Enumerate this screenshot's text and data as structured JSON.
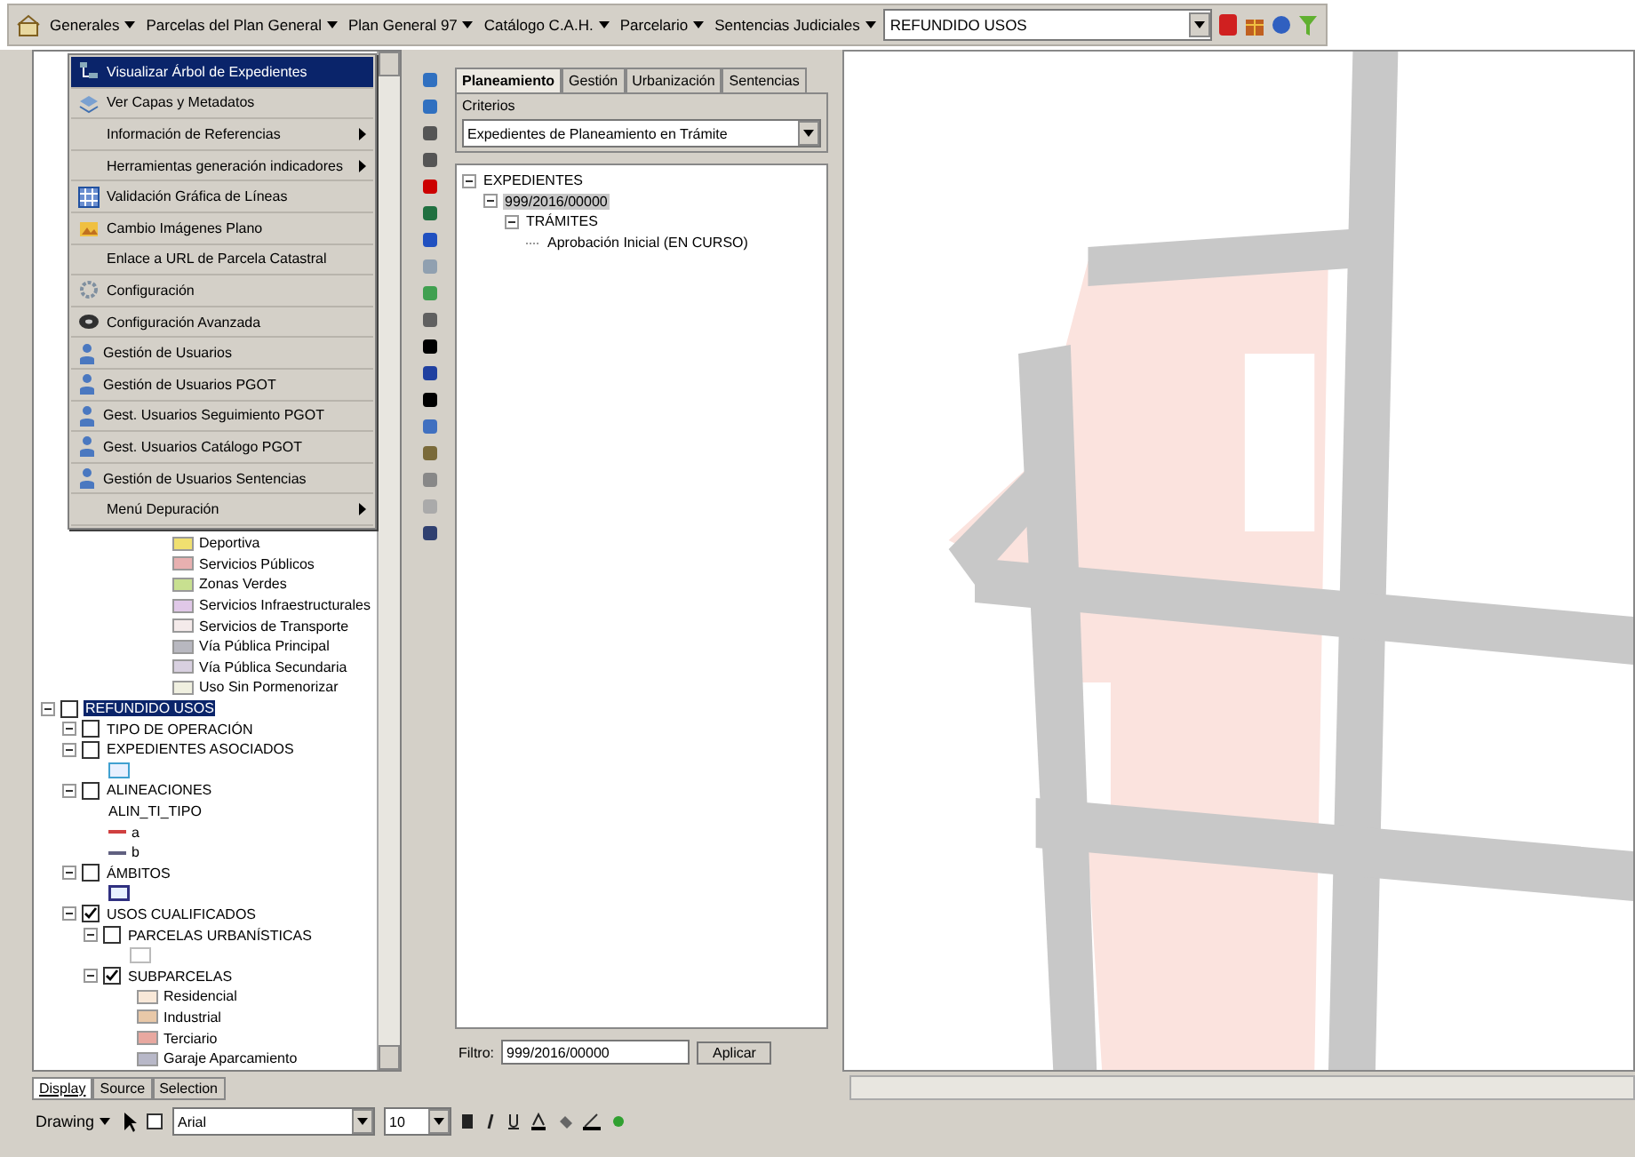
{
  "toolbar": {
    "menus": [
      {
        "label": "Generales"
      },
      {
        "label": "Parcelas del Plan General"
      },
      {
        "label": "Plan General 97"
      },
      {
        "label": "Catálogo C.A.H."
      },
      {
        "label": "Parcelario"
      },
      {
        "label": "Sentencias Judiciales"
      }
    ],
    "layer_combo": {
      "value": "REFUNDIDO USOS"
    }
  },
  "menu": {
    "items": [
      {
        "label": "Visualizar Árbol de Expedientes",
        "selected": true,
        "submenu": false,
        "kind": "tree"
      },
      {
        "label": "Ver Capas y Metadatos",
        "selected": false,
        "submenu": false,
        "kind": "layers"
      },
      {
        "label": "Información de Referencias",
        "selected": false,
        "submenu": true,
        "kind": "plain"
      },
      {
        "label": "Herramientas generación indicadores",
        "selected": false,
        "submenu": true,
        "kind": "plain"
      },
      {
        "label": "Validación Gráfica de Líneas",
        "selected": false,
        "submenu": false,
        "kind": "grid"
      },
      {
        "label": "Cambio Imágenes Plano",
        "selected": false,
        "submenu": false,
        "kind": "image"
      },
      {
        "label": "Enlace a URL de Parcela Catastral",
        "selected": false,
        "submenu": false,
        "kind": "plain"
      },
      {
        "label": "Configuración",
        "selected": false,
        "submenu": false,
        "kind": "gear"
      },
      {
        "label": "Configuración Avanzada",
        "selected": false,
        "submenu": false,
        "kind": "disk"
      },
      {
        "label": "Gestión de Usuarios",
        "selected": false,
        "submenu": false,
        "kind": "user"
      },
      {
        "label": "Gestión de Usuarios PGOT",
        "selected": false,
        "submenu": false,
        "kind": "user"
      },
      {
        "label": "Gest. Usuarios Seguimiento PGOT",
        "selected": false,
        "submenu": false,
        "kind": "user"
      },
      {
        "label": "Gest. Usuarios Catálogo PGOT",
        "selected": false,
        "submenu": false,
        "kind": "user"
      },
      {
        "label": "Gestión de Usuarios Sentencias",
        "selected": false,
        "submenu": false,
        "kind": "user"
      },
      {
        "label": "Menú Depuración",
        "selected": false,
        "submenu": true,
        "kind": "plain"
      }
    ]
  },
  "toc": {
    "legend_top": [
      {
        "label": "Deportiva",
        "color": "#f0e070"
      },
      {
        "label": "Servicios Públicos",
        "color": "#e8b0b0"
      },
      {
        "label": "Zonas Verdes",
        "color": "#c8e090"
      },
      {
        "label": "Servicios Infraestructurales",
        "color": "#e0c8e8"
      },
      {
        "label": "Servicios de Transporte",
        "color": "#f4eaea"
      },
      {
        "label": "Vía Pública Principal",
        "color": "#b8b8c0"
      },
      {
        "label": "Vía Pública Secundaria",
        "color": "#d8d0e0"
      },
      {
        "label": "Uso Sin Pormenorizar",
        "color": "#f0f0e0"
      }
    ],
    "layers": [
      {
        "label": "REFUNDIDO USOS",
        "checked": false,
        "selected": true,
        "children": [
          {
            "label": "TIPO DE OPERACIÓN",
            "checked": false,
            "selected": false,
            "kind": "plain"
          },
          {
            "label": "EXPEDIENTES ASOCIADOS",
            "checked": false,
            "selected": false,
            "kind": "polygon"
          },
          {
            "label": "ALINEACIONES",
            "checked": false,
            "selected": false,
            "kind": "lines",
            "field": "ALIN_TI_TIPO",
            "lines": [
              {
                "label": "a",
                "color": "#d04040"
              },
              {
                "label": "b",
                "color": "#606080"
              }
            ]
          },
          {
            "label": "ÁMBITOS",
            "checked": false,
            "selected": false,
            "kind": "box"
          },
          {
            "label": "USOS CUALIFICADOS",
            "checked": true,
            "selected": false,
            "children": [
              {
                "label": "PARCELAS URBANÍSTICAS",
                "checked": false,
                "selected": false,
                "kind": "empty"
              },
              {
                "label": "SUBPARCELAS",
                "checked": true,
                "selected": false,
                "kind": "legend",
                "legend": [
                  {
                    "label": "Residencial",
                    "color": "#f8e8d8"
                  },
                  {
                    "label": "Industrial",
                    "color": "#e8c8a8"
                  },
                  {
                    "label": "Terciario",
                    "color": "#e8a8a0"
                  },
                  {
                    "label": "Garaje Aparcamiento",
                    "color": "#b8b8c8"
                  }
                ]
              }
            ]
          }
        ]
      }
    ],
    "tabs": [
      {
        "label": "Display",
        "selected": true
      },
      {
        "label": "Source",
        "selected": false
      },
      {
        "label": "Selection",
        "selected": false
      }
    ]
  },
  "expedientes": {
    "tabs": [
      {
        "label": "Planeamiento",
        "selected": true
      },
      {
        "label": "Gestión",
        "selected": false
      },
      {
        "label": "Urbanización",
        "selected": false
      },
      {
        "label": "Sentencias",
        "selected": false
      }
    ],
    "criteria_label": "Criterios",
    "criteria": "Expedientes de Planeamiento en Trámite",
    "tree": [
      {
        "label": "EXPEDIENTES",
        "selected": false,
        "children": [
          {
            "label": "999/2016/00000",
            "selected": true,
            "children": [
              {
                "label": "TRÁMITES",
                "selected": false,
                "children": [
                  {
                    "label": "Aprobación Inicial (EN CURSO)",
                    "selected": false
                  }
                ]
              }
            ]
          }
        ]
      }
    ],
    "filter_label": "Filtro:",
    "filter_value": "999/2016/00000",
    "apply": "Aplicar"
  },
  "drawing_toolbar": {
    "menu": "Drawing",
    "font": "Arial",
    "size": "10"
  }
}
